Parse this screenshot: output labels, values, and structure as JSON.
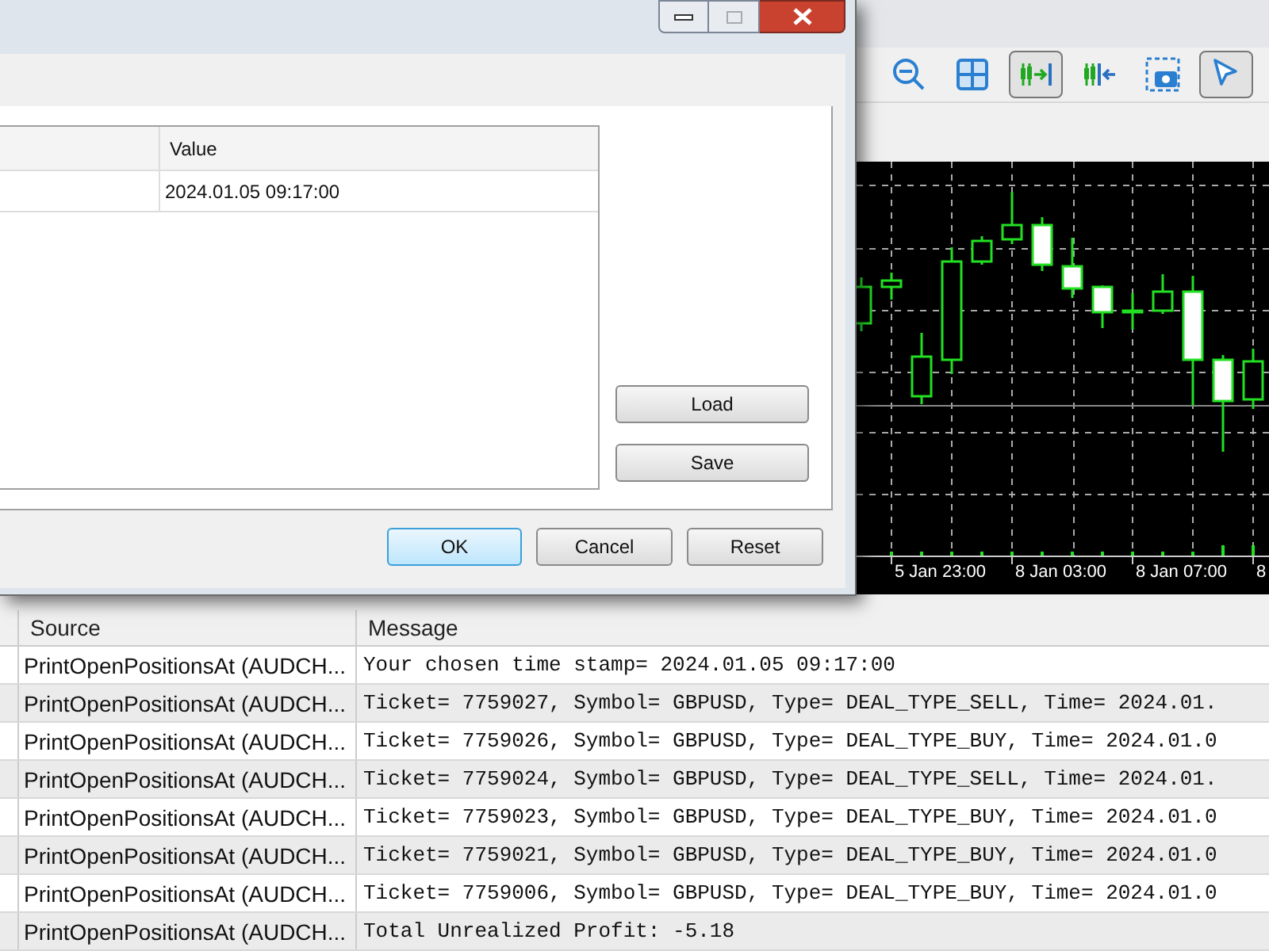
{
  "dialog": {
    "table": {
      "columns": [
        "Value"
      ],
      "rows": [
        {
          "value": "2024.01.05 09:17:00"
        }
      ]
    },
    "side_buttons": [
      "Load",
      "Save"
    ],
    "buttons": [
      {
        "label": "OK",
        "default": true
      },
      {
        "label": "Cancel",
        "default": false
      },
      {
        "label": "Reset",
        "default": false
      }
    ]
  },
  "toolbar": {
    "items": [
      {
        "kind": "zoom-out",
        "selected": false
      },
      {
        "kind": "grid",
        "selected": false
      },
      {
        "kind": "shift",
        "selected": true
      },
      {
        "kind": "autoscroll",
        "selected": false
      },
      {
        "kind": "screenshot",
        "selected": false
      },
      {
        "kind": "cursor",
        "selected": true
      }
    ]
  },
  "chart": {
    "x_labels": [
      "5 Jan 23:00",
      "8 Jan 03:00",
      "8 Jan 07:00",
      "8"
    ]
  },
  "journal": {
    "columns": [
      "Source",
      "Message"
    ],
    "rows": [
      {
        "source": "PrintOpenPositionsAt (AUDCH...",
        "message": "Your chosen time stamp= 2024.01.05 09:17:00"
      },
      {
        "source": "PrintOpenPositionsAt (AUDCH...",
        "message": "Ticket= 7759027, Symbol= GBPUSD, Type= DEAL_TYPE_SELL, Time= 2024.01."
      },
      {
        "source": "PrintOpenPositionsAt (AUDCH...",
        "message": "Ticket= 7759026, Symbol= GBPUSD, Type= DEAL_TYPE_BUY, Time= 2024.01.0"
      },
      {
        "source": "PrintOpenPositionsAt (AUDCH...",
        "message": "Ticket= 7759024, Symbol= GBPUSD, Type= DEAL_TYPE_SELL, Time= 2024.01."
      },
      {
        "source": "PrintOpenPositionsAt (AUDCH...",
        "message": "Ticket= 7759023, Symbol= GBPUSD, Type= DEAL_TYPE_BUY, Time= 2024.01.0"
      },
      {
        "source": "PrintOpenPositionsAt (AUDCH...",
        "message": "Ticket= 7759021, Symbol= GBPUSD, Type= DEAL_TYPE_BUY, Time= 2024.01.0"
      },
      {
        "source": "PrintOpenPositionsAt (AUDCH...",
        "message": "Ticket= 7759006, Symbol= GBPUSD, Type= DEAL_TYPE_BUY, Time= 2024.01.0"
      },
      {
        "source": "PrintOpenPositionsAt (AUDCH...",
        "message": "Total Unrealized Profit: -5.18"
      }
    ]
  }
}
